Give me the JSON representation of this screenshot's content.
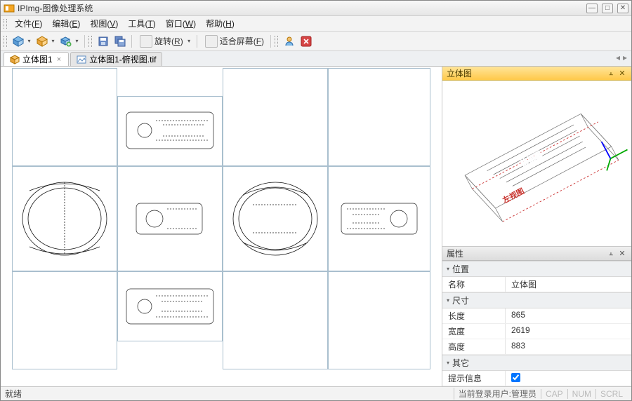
{
  "window": {
    "title": "IPImg-图像处理系统"
  },
  "menu": {
    "file": {
      "label": "文件",
      "accel": "F"
    },
    "edit": {
      "label": "编辑",
      "accel": "E"
    },
    "view": {
      "label": "视图",
      "accel": "V"
    },
    "tool": {
      "label": "工具",
      "accel": "T"
    },
    "window": {
      "label": "窗口",
      "accel": "W"
    },
    "help": {
      "label": "帮助",
      "accel": "H"
    }
  },
  "toolbar": {
    "rotate_label": "旋转",
    "rotate_accel": "R",
    "fit_label": "适合屏幕",
    "fit_accel": "F"
  },
  "tabs": {
    "t1": "立体图1",
    "t2": "立体图1-俯视图.tif"
  },
  "panes": {
    "view3d_title": "立体图",
    "view3d_label_top": "俯视图",
    "view3d_label_left": "左视图",
    "props_title": "属性",
    "cat_pos": "位置",
    "cat_dim": "尺寸",
    "cat_other": "其它",
    "k_name": "名称",
    "v_name": "立体图",
    "k_len": "长度",
    "v_len": "865",
    "k_width": "宽度",
    "v_width": "2619",
    "k_height": "高度",
    "v_height": "883",
    "k_hint": "提示信息"
  },
  "status": {
    "ready": "就绪",
    "user_label": "当前登录用户:管理员",
    "cap": "CAP",
    "num": "NUM",
    "scrl": "SCRL"
  }
}
